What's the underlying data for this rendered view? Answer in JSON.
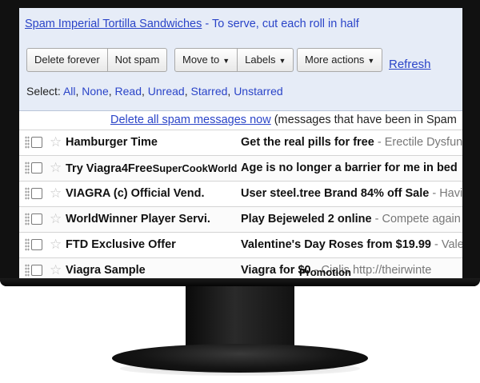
{
  "subject_bar": {
    "link_text": "Spam Imperial Tortilla Sandwiches",
    "rest_text": " - To serve, cut each roll in half"
  },
  "toolbar": {
    "delete_forever": "Delete forever",
    "not_spam": "Not spam",
    "move_to": "Move to",
    "labels": "Labels",
    "more_actions": "More actions",
    "refresh": "Refresh",
    "arrow_glyph": "▼"
  },
  "select": {
    "label": "Select:",
    "options": [
      "All",
      "None",
      "Read",
      "Unread",
      "Starred",
      "Unstarred"
    ]
  },
  "notice": {
    "link": "Delete all spam messages now",
    "text": " (messages that have been in Spam"
  },
  "messages": [
    {
      "sender": "Hamburger Time",
      "subject": "Get the real pills for free",
      "snippet": " - Erectile Dysfun"
    },
    {
      "sender": "Try Viagra4Free",
      "sender_overlay": "SuperCookWorld",
      "subject": "Age is no longer a barrier for me in bed",
      "snippet": ""
    },
    {
      "sender": "VIAGRA (c) Official Vend.",
      "subject": "User steel.tree Brand 84% off Sale",
      "snippet": " - Havi"
    },
    {
      "sender": "WorldWinner Player Servi.",
      "subject": "Play Bejeweled 2 online",
      "snippet": " - Compete again"
    },
    {
      "sender": "FTD Exclusive Offer",
      "subject": "Valentine's Day Roses from $19.99",
      "snippet": " - Vale"
    },
    {
      "sender": "Viagra Sample",
      "subject": "Viagra for $0",
      "subject_overlay": "Promotion",
      "snippet": " - Cialis http://theirwinte"
    }
  ],
  "colors": {
    "link": "#2a44c8",
    "toolbar_bg": "#e6ecf7",
    "monitor": "#111111"
  }
}
